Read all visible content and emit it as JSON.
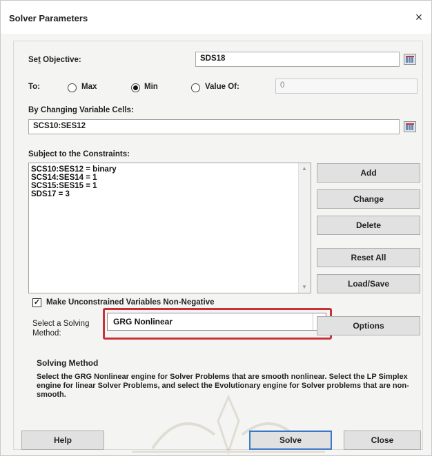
{
  "window": {
    "title": "Solver Parameters",
    "close_glyph": "×"
  },
  "objective": {
    "label_pre": "Se",
    "label_u": "t",
    "label_post": " Objective:",
    "value": "SDS18"
  },
  "to": {
    "label": "To:",
    "max_label": "Max",
    "min_label": "Min",
    "value_of_label": "Value Of:",
    "value_of_value": "0",
    "selected": "Min"
  },
  "changing": {
    "label": "By Changing Variable Cells:",
    "value": "SCS10:SES12"
  },
  "constraints": {
    "label": "Subject to the Constraints:",
    "items": [
      "SCS10:SES12 = binary",
      "SCS14:SES14 = 1",
      "SCS15:SES15 = 1",
      "SDS17 = 3"
    ]
  },
  "side_buttons": {
    "add": "Add",
    "change": "Change",
    "delete": "Delete",
    "reset_all": "Reset All",
    "load_save": "Load/Save"
  },
  "nonneg": {
    "label": "Make Unconstrained Variables Non-Negative",
    "checked": "✓"
  },
  "method": {
    "label_line1": "Select a Solving",
    "label_line2": "Method:",
    "selected": "GRG Nonlinear",
    "options_button": "Options"
  },
  "solving_method": {
    "title": "Solving Method",
    "description": "Select the GRG Nonlinear engine for Solver Problems that are smooth nonlinear. Select the LP Simplex engine for linear Solver Problems, and select the Evolutionary engine for Solver problems that are non-smooth."
  },
  "footer": {
    "help": "Help",
    "solve": "Solve",
    "close": "Close"
  },
  "colors": {
    "highlight": "#c8303a",
    "primary_border": "#3c78c8"
  }
}
